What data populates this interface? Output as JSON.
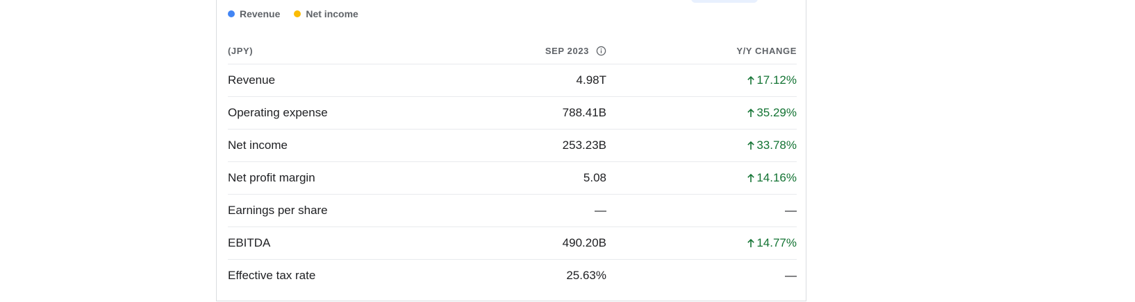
{
  "legend": {
    "items": [
      {
        "label": "Revenue",
        "color": "#4285f4"
      },
      {
        "label": "Net income",
        "color": "#fbbc04"
      }
    ]
  },
  "table": {
    "headers": {
      "name": "(JPY)",
      "value": "SEP 2023",
      "change": "Y/Y CHANGE"
    },
    "rows": [
      {
        "name": "Revenue",
        "value": "4.98T",
        "change": "17.12%",
        "direction": "up"
      },
      {
        "name": "Operating expense",
        "value": "788.41B",
        "change": "35.29%",
        "direction": "up"
      },
      {
        "name": "Net income",
        "value": "253.23B",
        "change": "33.78%",
        "direction": "up"
      },
      {
        "name": "Net profit margin",
        "value": "5.08",
        "change": "14.16%",
        "direction": "up"
      },
      {
        "name": "Earnings per share",
        "value": "—",
        "change": "—",
        "direction": "none"
      },
      {
        "name": "EBITDA",
        "value": "490.20B",
        "change": "14.77%",
        "direction": "up"
      },
      {
        "name": "Effective tax rate",
        "value": "25.63%",
        "change": "—",
        "direction": "none"
      }
    ]
  },
  "colors": {
    "positive": "#137333",
    "muted": "#5f6368"
  }
}
